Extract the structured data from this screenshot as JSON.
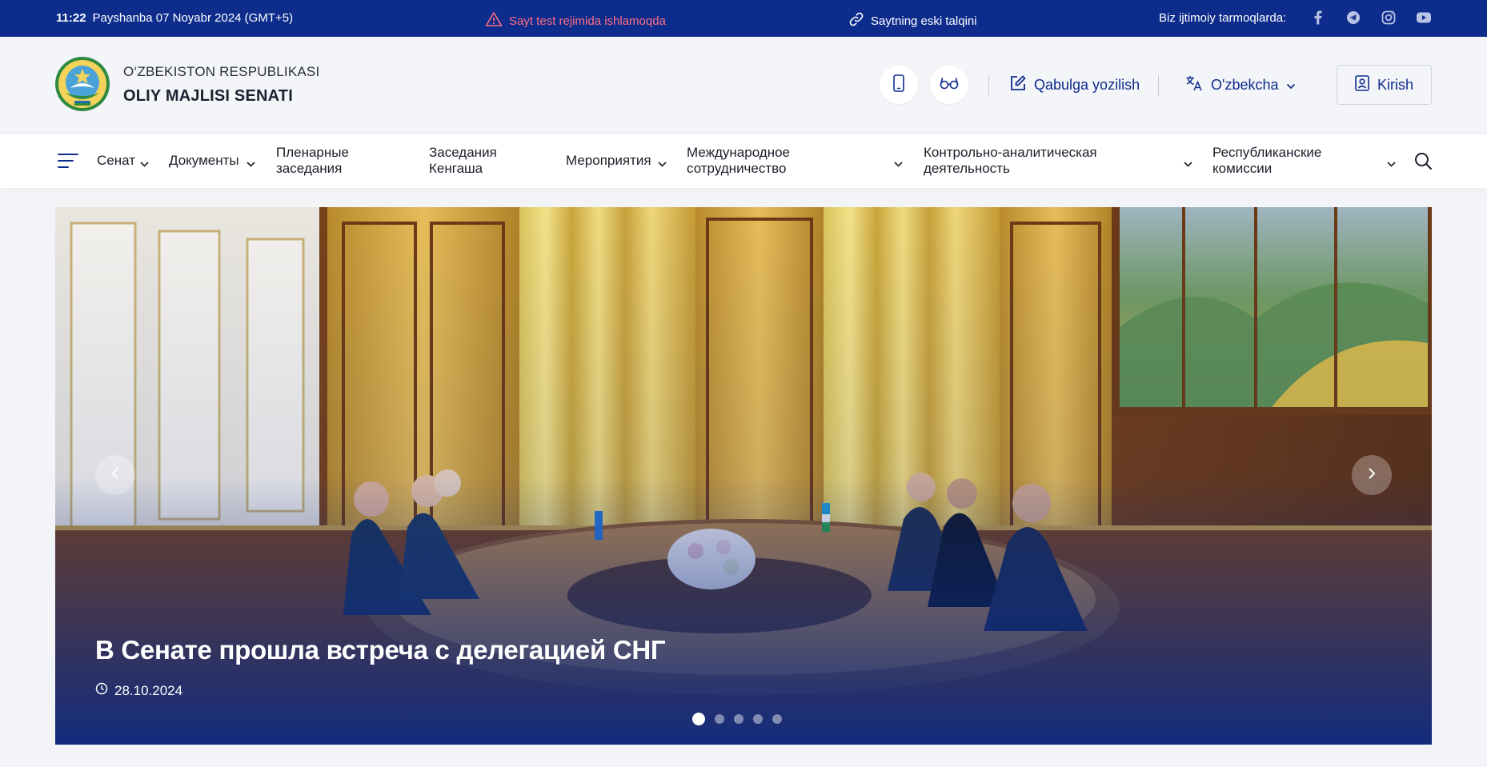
{
  "topbar": {
    "time": "11:22",
    "date": "Payshanba 07 Noyabr 2024 (GMT+5)",
    "warning": "Sayt test rejimida ishlamoqda",
    "old_site": "Saytning eski talqini",
    "social_label": "Biz ijtimoiy tarmoqlarda:",
    "social_icons": [
      "facebook-icon",
      "telegram-icon",
      "instagram-icon",
      "youtube-icon"
    ]
  },
  "header": {
    "brand_line1": "O‘ZBEKISTON RESPUBLIKASI",
    "brand_line2": "OLIY MAJLISI SENATI",
    "appointment": "Qabulga yozilish",
    "language": "O'zbekcha",
    "login": "Kirish"
  },
  "nav": {
    "items": [
      {
        "label": "Сенат"
      },
      {
        "label": "Документы"
      },
      {
        "label": "Пленарные заседания"
      },
      {
        "label": "Заседания Кенгаша"
      },
      {
        "label": "Мероприятия"
      },
      {
        "label": "Международное сотрудничество"
      },
      {
        "label": "Контрольно-аналитическая деятельность"
      },
      {
        "label": "Республиканские комиссии"
      }
    ]
  },
  "hero": {
    "title": "В Сенате прошла встреча с делегацией СНГ",
    "date": "28.10.2024",
    "slides_total": 5,
    "active_slide": 1
  },
  "colors": {
    "primary": "#0d2c8c",
    "warning": "#ff6f83"
  }
}
